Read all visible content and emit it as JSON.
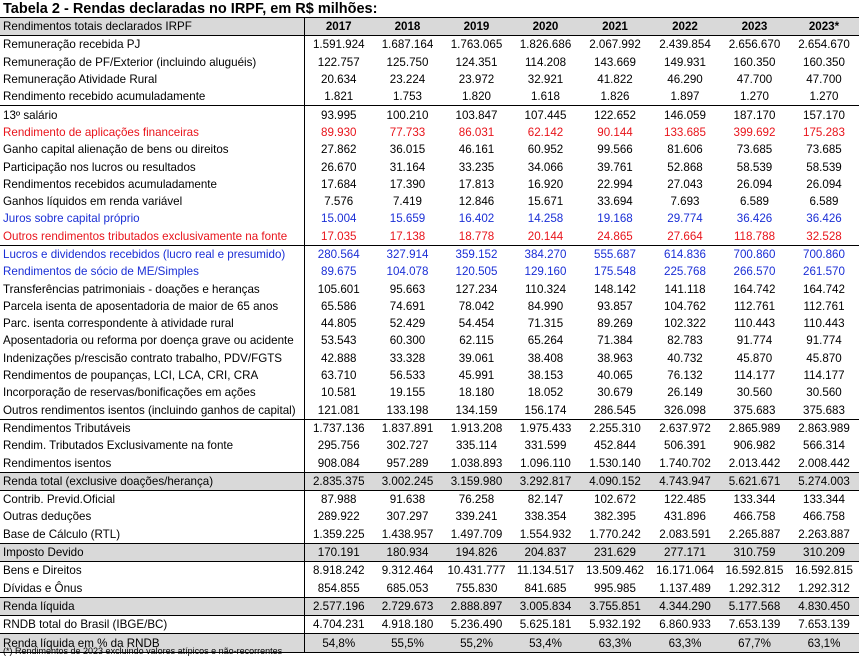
{
  "title": "Tabela 2 - Rendas declaradas no IRPF, em R$ milhões:",
  "header": [
    "Rendimentos totais declarados IRPF",
    "2017",
    "2018",
    "2019",
    "2020",
    "2021",
    "2022",
    "2023",
    "2023*"
  ],
  "rows": [
    {
      "label": "Remuneração recebida PJ",
      "values": [
        "1.591.924",
        "1.687.164",
        "1.763.065",
        "1.826.686",
        "2.067.992",
        "2.439.854",
        "2.656.670",
        "2.654.670"
      ]
    },
    {
      "label": "Remuneração de PF/Exterior (incluindo aluguéis)",
      "values": [
        "122.757",
        "125.750",
        "124.351",
        "114.208",
        "143.669",
        "149.931",
        "160.350",
        "160.350"
      ]
    },
    {
      "label": "Remuneração Atividade Rural",
      "values": [
        "20.634",
        "23.224",
        "23.972",
        "32.921",
        "41.822",
        "46.290",
        "47.700",
        "47.700"
      ]
    },
    {
      "label": "Rendimento recebido acumuladamente",
      "values": [
        "1.821",
        "1.753",
        "1.820",
        "1.618",
        "1.826",
        "1.897",
        "1.270",
        "1.270"
      ]
    },
    {
      "label": "13º salário",
      "values": [
        "93.995",
        "100.210",
        "103.847",
        "107.445",
        "122.652",
        "146.059",
        "187.170",
        "157.170"
      ]
    },
    {
      "label": "Rendimento de aplicações financeiras",
      "values": [
        "89.930",
        "77.733",
        "86.031",
        "62.142",
        "90.144",
        "133.685",
        "399.692",
        "175.283"
      ]
    },
    {
      "label": "Ganho capital alienação de bens ou direitos",
      "values": [
        "27.862",
        "36.015",
        "46.161",
        "60.952",
        "99.566",
        "81.606",
        "73.685",
        "73.685"
      ]
    },
    {
      "label": "Participação nos lucros ou resultados",
      "values": [
        "26.670",
        "31.164",
        "33.235",
        "34.066",
        "39.761",
        "52.868",
        "58.539",
        "58.539"
      ]
    },
    {
      "label": "Rendimentos recebidos acumuladamente",
      "values": [
        "17.684",
        "17.390",
        "17.813",
        "16.920",
        "22.994",
        "27.043",
        "26.094",
        "26.094"
      ]
    },
    {
      "label": "Ganhos líquidos em renda variável",
      "values": [
        "7.576",
        "7.419",
        "12.846",
        "15.671",
        "33.694",
        "7.693",
        "6.589",
        "6.589"
      ]
    },
    {
      "label": "Juros sobre capital próprio",
      "values": [
        "15.004",
        "15.659",
        "16.402",
        "14.258",
        "19.168",
        "29.774",
        "36.426",
        "36.426"
      ]
    },
    {
      "label": "Outros rendimentos tributados exclusivamente na fonte",
      "values": [
        "17.035",
        "17.138",
        "18.778",
        "20.144",
        "24.865",
        "27.664",
        "118.788",
        "32.528"
      ]
    },
    {
      "label": "Lucros e dividendos recebidos (lucro real e presumido)",
      "values": [
        "280.564",
        "327.914",
        "359.152",
        "384.270",
        "555.687",
        "614.836",
        "700.860",
        "700.860"
      ]
    },
    {
      "label": "Rendimentos de sócio de ME/Simples",
      "values": [
        "89.675",
        "104.078",
        "120.505",
        "129.160",
        "175.548",
        "225.768",
        "266.570",
        "261.570"
      ]
    },
    {
      "label": "Transferências patrimoniais - doações e heranças",
      "values": [
        "105.601",
        "95.663",
        "127.234",
        "110.324",
        "148.142",
        "141.118",
        "164.742",
        "164.742"
      ]
    },
    {
      "label": "Parcela isenta de aposentadoria de maior de 65 anos",
      "values": [
        "65.586",
        "74.691",
        "78.042",
        "84.990",
        "93.857",
        "104.762",
        "112.761",
        "112.761"
      ]
    },
    {
      "label": "Parc. isenta correspondente à atividade rural",
      "values": [
        "44.805",
        "52.429",
        "54.454",
        "71.315",
        "89.269",
        "102.322",
        "110.443",
        "110.443"
      ]
    },
    {
      "label": "Aposentadoria ou reforma por doença grave ou acidente",
      "values": [
        "53.543",
        "60.300",
        "62.115",
        "65.264",
        "71.384",
        "82.783",
        "91.774",
        "91.774"
      ]
    },
    {
      "label": "Indenizações p/rescisão contrato trabalho, PDV/FGTS",
      "values": [
        "42.888",
        "33.328",
        "39.061",
        "38.408",
        "38.963",
        "40.732",
        "45.870",
        "45.870"
      ]
    },
    {
      "label": "Rendimentos de poupanças, LCI, LCA, CRI, CRA",
      "values": [
        "63.710",
        "56.533",
        "45.991",
        "38.153",
        "40.065",
        "76.132",
        "114.177",
        "114.177"
      ]
    },
    {
      "label": "Incorporação de reservas/bonificações em ações",
      "values": [
        "10.581",
        "19.155",
        "18.180",
        "18.052",
        "30.679",
        "26.149",
        "30.560",
        "30.560"
      ]
    },
    {
      "label": "Outros rendimentos isentos (incluindo ganhos de capital)",
      "values": [
        "121.081",
        "133.198",
        "134.159",
        "156.174",
        "286.545",
        "326.098",
        "375.683",
        "375.683"
      ]
    },
    {
      "label": "Rendimentos Tributáveis",
      "values": [
        "1.737.136",
        "1.837.891",
        "1.913.208",
        "1.975.433",
        "2.255.310",
        "2.637.972",
        "2.865.989",
        "2.863.989"
      ]
    },
    {
      "label": "Rendim. Tributados Exclusivamente na fonte",
      "values": [
        "295.756",
        "302.727",
        "335.114",
        "331.599",
        "452.844",
        "506.391",
        "906.982",
        "566.314"
      ]
    },
    {
      "label": "Rendimentos isentos",
      "values": [
        "908.084",
        "957.289",
        "1.038.893",
        "1.096.110",
        "1.530.140",
        "1.740.702",
        "2.013.442",
        "2.008.442"
      ]
    },
    {
      "label": "Renda total (exclusive doações/herança)",
      "values": [
        "2.835.375",
        "3.002.245",
        "3.159.980",
        "3.292.817",
        "4.090.152",
        "4.743.947",
        "5.621.671",
        "5.274.003"
      ]
    },
    {
      "label": "Contrib. Previd.Oficial",
      "values": [
        "87.988",
        "91.638",
        "76.258",
        "82.147",
        "102.672",
        "122.485",
        "133.344",
        "133.344"
      ]
    },
    {
      "label": "Outras deduções",
      "values": [
        "289.922",
        "307.297",
        "339.241",
        "338.354",
        "382.395",
        "431.896",
        "466.758",
        "466.758"
      ]
    },
    {
      "label": "Base de Cálculo (RTL)",
      "values": [
        "1.359.225",
        "1.438.957",
        "1.497.709",
        "1.554.932",
        "1.770.242",
        "2.083.591",
        "2.265.887",
        "2.263.887"
      ]
    },
    {
      "label": "Imposto Devido",
      "values": [
        "170.191",
        "180.934",
        "194.826",
        "204.837",
        "231.629",
        "277.171",
        "310.759",
        "310.209"
      ]
    },
    {
      "label": "Bens e Direitos",
      "values": [
        "8.918.242",
        "9.312.464",
        "10.431.777",
        "11.134.517",
        "13.509.462",
        "16.171.064",
        "16.592.815",
        "16.592.815"
      ]
    },
    {
      "label": "Dívidas e Ônus",
      "values": [
        "854.855",
        "685.053",
        "755.830",
        "841.685",
        "995.985",
        "1.137.489",
        "1.292.312",
        "1.292.312"
      ]
    },
    {
      "label": "Renda líquida",
      "values": [
        "2.577.196",
        "2.729.673",
        "2.888.897",
        "3.005.834",
        "3.755.851",
        "4.344.290",
        "5.177.568",
        "4.830.450"
      ]
    },
    {
      "label": "RNDB total do Brasil (IBGE/BC)",
      "values": [
        "4.704.231",
        "4.918.180",
        "5.236.490",
        "5.625.181",
        "5.932.192",
        "6.860.933",
        "7.653.139",
        "7.653.139"
      ]
    },
    {
      "label": "Renda líquida em % da RNDB",
      "values": [
        "54,8%",
        "55,5%",
        "55,2%",
        "53,4%",
        "63,3%",
        "63,3%",
        "67,7%",
        "63,1%"
      ]
    }
  ],
  "footnote": "(*) Rendimentos de 2023 excluindo valores atípicos e não-recorrentes",
  "colors": {
    "red": "#e8141b",
    "blue": "#1b2fd6",
    "shade": "#d9d9d9"
  }
}
